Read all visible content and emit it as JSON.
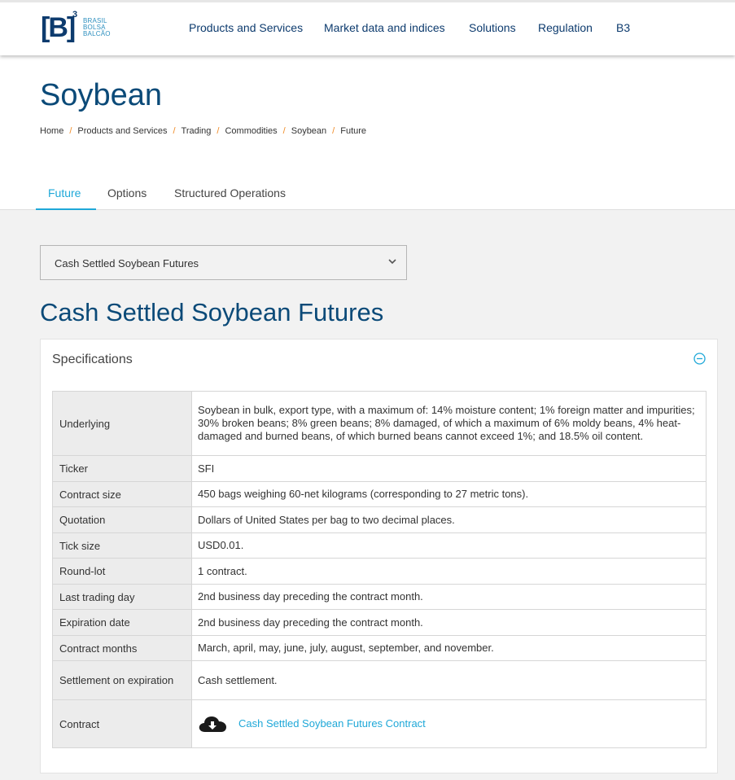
{
  "logo": {
    "mark": "[B]",
    "superscript": "3",
    "words": [
      "BRASIL",
      "BOLSA",
      "BALCÃO"
    ]
  },
  "nav": {
    "items": [
      {
        "label": "Products and Services"
      },
      {
        "label": "Market data and indices"
      },
      {
        "label": "Solutions"
      },
      {
        "label": "Regulation"
      },
      {
        "label": "B3"
      }
    ]
  },
  "page": {
    "title": "Soybean"
  },
  "breadcrumb": [
    "Home",
    "Products and Services",
    "Trading",
    "Commodities",
    "Soybean",
    "Future"
  ],
  "tabs": [
    {
      "label": "Future",
      "active": true
    },
    {
      "label": "Options",
      "active": false
    },
    {
      "label": "Structured Operations",
      "active": false
    }
  ],
  "product_select": {
    "selected": "Cash Settled Soybean Futures"
  },
  "product": {
    "title": "Cash Settled Soybean Futures"
  },
  "specifications": {
    "heading": "Specifications",
    "rows": [
      {
        "key": "Underlying",
        "value": "Soybean in bulk, export type, with a maximum of: 14% moisture content; 1% foreign matter and impurities; 30% broken beans; 8% green beans; 8% damaged, of which a maximum of 6% moldy beans, 4% heat-damaged and burned beans, of which burned beans cannot exceed 1%; and 18.5% oil content."
      },
      {
        "key": "Ticker",
        "value": "SFI"
      },
      {
        "key": "Contract size",
        "value": "450 bags weighing 60-net kilograms (corresponding to 27 metric tons)."
      },
      {
        "key": "Quotation",
        "value": "Dollars of United States per bag to two decimal places."
      },
      {
        "key": "Tick size",
        "value": "USD0.01."
      },
      {
        "key": "Round-lot",
        "value": "1 contract."
      },
      {
        "key": "Last trading day",
        "value": "2nd business day preceding the contract month."
      },
      {
        "key": "Expiration date",
        "value": "2nd business day preceding the contract month."
      },
      {
        "key": "Contract months",
        "value": "March, april, may, june, july, august, september, and november."
      },
      {
        "key": "Settlement on expiration",
        "value": "Cash settlement."
      }
    ],
    "contract": {
      "key": "Contract",
      "link_label": "Cash Settled Soybean Futures Contract",
      "icon": "cloud-download-icon"
    }
  },
  "colors": {
    "brand_navy": "#0b4a78",
    "accent_blue": "#1fa8d8",
    "breadcrumb_separator": "#f08a24"
  }
}
